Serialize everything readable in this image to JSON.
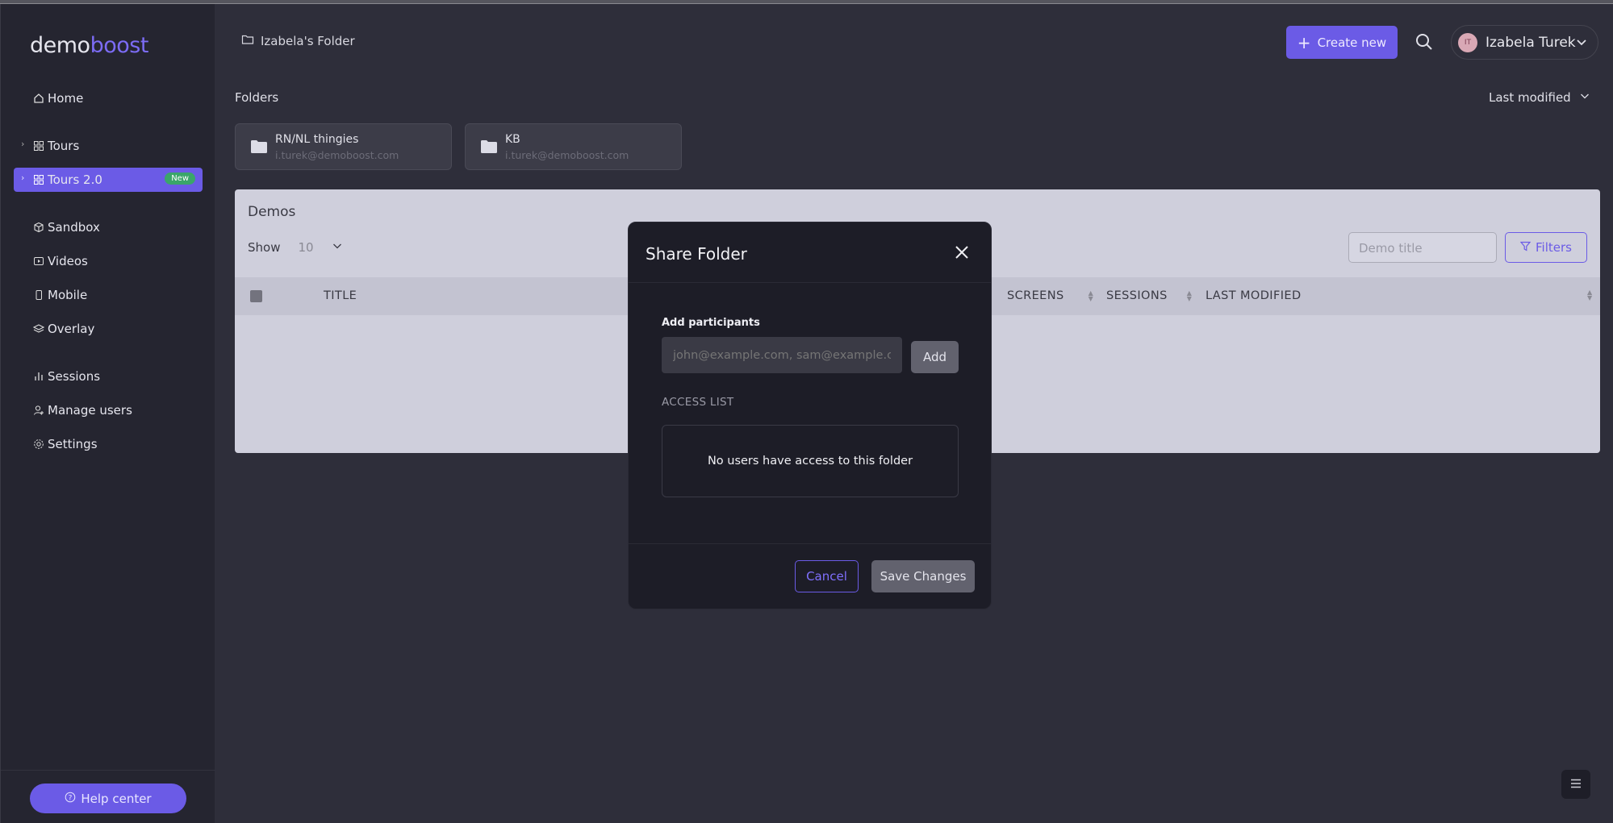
{
  "app": {
    "logo_part1": "demo",
    "logo_part2": "boost"
  },
  "sidebar": {
    "items": [
      {
        "label": "Home",
        "icon": "home-icon"
      },
      {
        "label": "Tours",
        "icon": "grid-icon"
      },
      {
        "label": "Tours 2.0",
        "icon": "grid-icon",
        "badge": "New"
      },
      {
        "label": "Sandbox",
        "icon": "cube-icon"
      },
      {
        "label": "Videos",
        "icon": "video-icon"
      },
      {
        "label": "Mobile",
        "icon": "mobile-icon"
      },
      {
        "label": "Overlay",
        "icon": "layers-icon"
      },
      {
        "label": "Sessions",
        "icon": "bar-chart-icon"
      },
      {
        "label": "Manage users",
        "icon": "user-icon"
      },
      {
        "label": "Settings",
        "icon": "gear-icon"
      }
    ],
    "help_label": "Help center"
  },
  "header": {
    "breadcrumb": "Izabela's Folder",
    "create_label": "Create new",
    "user_initials": "IT",
    "user_name": "Izabela Turek"
  },
  "folders": {
    "label": "Folders",
    "sort_label": "Last modified",
    "items": [
      {
        "name": "RN/NL thingies",
        "owner": "i.turek@demoboost.com"
      },
      {
        "name": "KB",
        "owner": "i.turek@demoboost.com"
      }
    ]
  },
  "demos": {
    "title": "Demos",
    "show_label": "Show",
    "show_value": "10",
    "search_placeholder": "Demo title",
    "filters_label": "Filters",
    "columns": [
      "TITLE",
      "SCREENS",
      "SESSIONS",
      "LAST MODIFIED"
    ]
  },
  "modal": {
    "title": "Share Folder",
    "participants_label": "Add participants",
    "participants_placeholder": "john@example.com, sam@example.com",
    "add_label": "Add",
    "access_label": "ACCESS LIST",
    "empty_text": "No users have access to this folder",
    "cancel_label": "Cancel",
    "save_label": "Save Changes"
  },
  "colors": {
    "accent": "#6b5be6",
    "badge": "#3aa66a",
    "background": "#2e2e3a",
    "sidebar": "#252530",
    "modal": "#1d1d27"
  }
}
